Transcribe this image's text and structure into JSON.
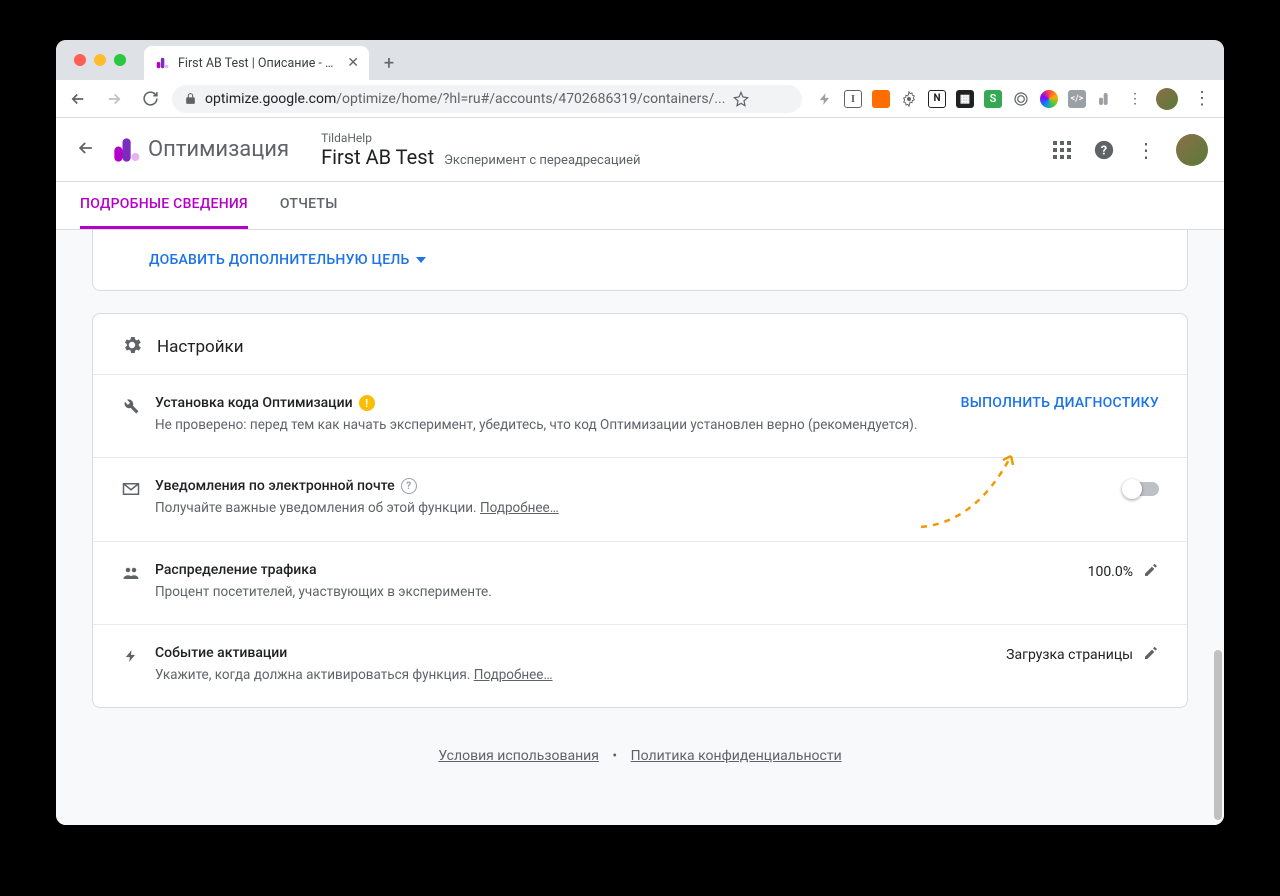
{
  "browser": {
    "tab_title": "First AB Test | Описание - Оп",
    "url_host": "optimize.google.com",
    "url_path": "/optimize/home/?hl=ru#/accounts/4702686319/containers/..."
  },
  "header": {
    "product": "Оптимизация",
    "account": "TildaHelp",
    "experiment_title": "First AB Test",
    "experiment_subtitle": "Эксперимент с переадресацией"
  },
  "tabs": {
    "details": "ПОДРОБНЫЕ СВЕДЕНИЯ",
    "reports": "ОТЧЕТЫ"
  },
  "goals": {
    "add_goal_label": "ДОБАВИТЬ ДОПОЛНИТЕЛЬНУЮ ЦЕЛЬ"
  },
  "settings": {
    "title": "Настройки",
    "install": {
      "title": "Установка кода Оптимизации",
      "desc": "Не проверено: перед тем как начать эксперимент, убедитесь, что код Оптимизации установлен верно (рекомендуется).",
      "action": "ВЫПОЛНИТЬ ДИАГНОСТИКУ"
    },
    "email": {
      "title": "Уведомления по электронной почте",
      "desc_prefix": "Получайте важные уведомления об этой функции. ",
      "learn_more": "Подробнее…"
    },
    "traffic": {
      "title": "Распределение трафика",
      "desc": "Процент посетителей, участвующих в эксперименте.",
      "value": "100.0%"
    },
    "activation": {
      "title": "Событие активации",
      "desc_prefix": "Укажите, когда должна активироваться функция. ",
      "learn_more": "Подробнее…",
      "value": "Загрузка страницы"
    }
  },
  "footer": {
    "terms": "Условия использования",
    "privacy": "Политика конфиденциальности"
  }
}
